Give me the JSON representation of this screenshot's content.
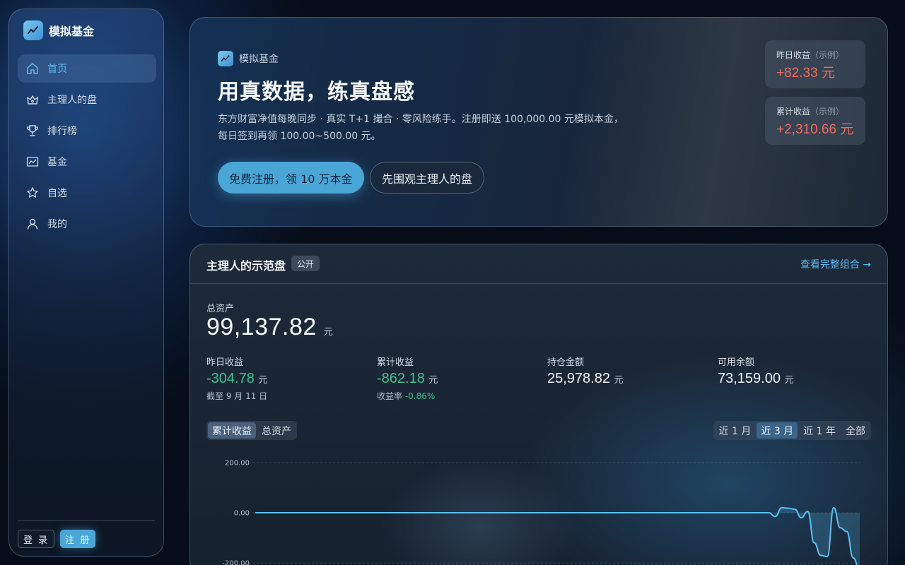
{
  "sidebar": {
    "brand": "模拟基金",
    "items": [
      {
        "label": "首页",
        "icon": "home-icon",
        "active": true
      },
      {
        "label": "主理人的盘",
        "icon": "crown-icon",
        "active": false
      },
      {
        "label": "排行榜",
        "icon": "trophy-icon",
        "active": false
      },
      {
        "label": "基金",
        "icon": "chart-line-icon",
        "active": false
      },
      {
        "label": "自选",
        "icon": "star-icon",
        "active": false
      },
      {
        "label": "我的",
        "icon": "user-icon",
        "active": false
      }
    ],
    "login_label": "登 录",
    "register_label": "注 册"
  },
  "hero": {
    "tag": "模拟基金",
    "title": "用真数据，练真盘感",
    "description": "东方财富净值每晚同步 · 真实 T+1 撮合 · 零风险练手。注册即送 100,000.00 元模拟本金，每日签到再领 100.00~500.00 元。",
    "cta_primary": "免费注册，领 10 万本金",
    "cta_secondary": "先围观主理人的盘",
    "stats": [
      {
        "label": "昨日收益",
        "note": "（示例）",
        "value": "+82.33",
        "unit": "元"
      },
      {
        "label": "累计收益",
        "note": "（示例）",
        "value": "+2,310.66",
        "unit": "元"
      }
    ]
  },
  "portfolio": {
    "title": "主理人的示范盘",
    "badge": "公开",
    "link": "查看完整组合 →",
    "total_label": "总资产",
    "total_value": "99,137.82",
    "unit": "元",
    "metrics": [
      {
        "label": "昨日收益",
        "value": "-304.78",
        "unit": "元",
        "note": "截至 9 月 11 日",
        "note_value": ""
      },
      {
        "label": "累计收益",
        "value": "-862.18",
        "unit": "元",
        "note": "收益率",
        "note_value": "-0.86%"
      },
      {
        "label": "持仓金额",
        "value": "25,978.82",
        "unit": "元",
        "note": "",
        "note_value": ""
      },
      {
        "label": "可用余额",
        "value": "73,159.00",
        "unit": "元",
        "note": "",
        "note_value": ""
      }
    ],
    "chart_tabs": [
      "累计收益",
      "总资产"
    ],
    "chart_tab_active": "累计收益",
    "range_tabs": [
      "近 1 月",
      "近 3 月",
      "近 1 年",
      "全部"
    ],
    "range_tab_active": "近 3 月"
  },
  "colors": {
    "accent": "#4aa6d6",
    "positive": "#f06a5e",
    "negative": "#3cc28f",
    "line": "#5cc0f0"
  },
  "chart_data": {
    "type": "area",
    "y_ticks": [
      "200.00",
      "0.00",
      "-200.00"
    ],
    "y_tick_values": [
      200,
      0,
      -200
    ],
    "ylim": [
      -200,
      200
    ],
    "grid": true,
    "series": [
      {
        "values": [
          0,
          0,
          0,
          0,
          0,
          0,
          0,
          0,
          0,
          0,
          0,
          0,
          0,
          0,
          0,
          0,
          0,
          0,
          0,
          0,
          0,
          0,
          0,
          0,
          0,
          0,
          0,
          0,
          0,
          0,
          0,
          0,
          0,
          0,
          0,
          0,
          0,
          0,
          0,
          0,
          0,
          0,
          0,
          0,
          0,
          0,
          0,
          0,
          0,
          0,
          0,
          0,
          0,
          0,
          0,
          0,
          0,
          0,
          0,
          0,
          0,
          0,
          0,
          0,
          0,
          0,
          0,
          0,
          0,
          0,
          0,
          0,
          0,
          0,
          0,
          0,
          0,
          0,
          0,
          0,
          -15,
          20,
          18,
          14,
          -20,
          5,
          -120,
          -170,
          -175,
          20,
          -60,
          -75,
          -180,
          -230
        ]
      }
    ]
  }
}
